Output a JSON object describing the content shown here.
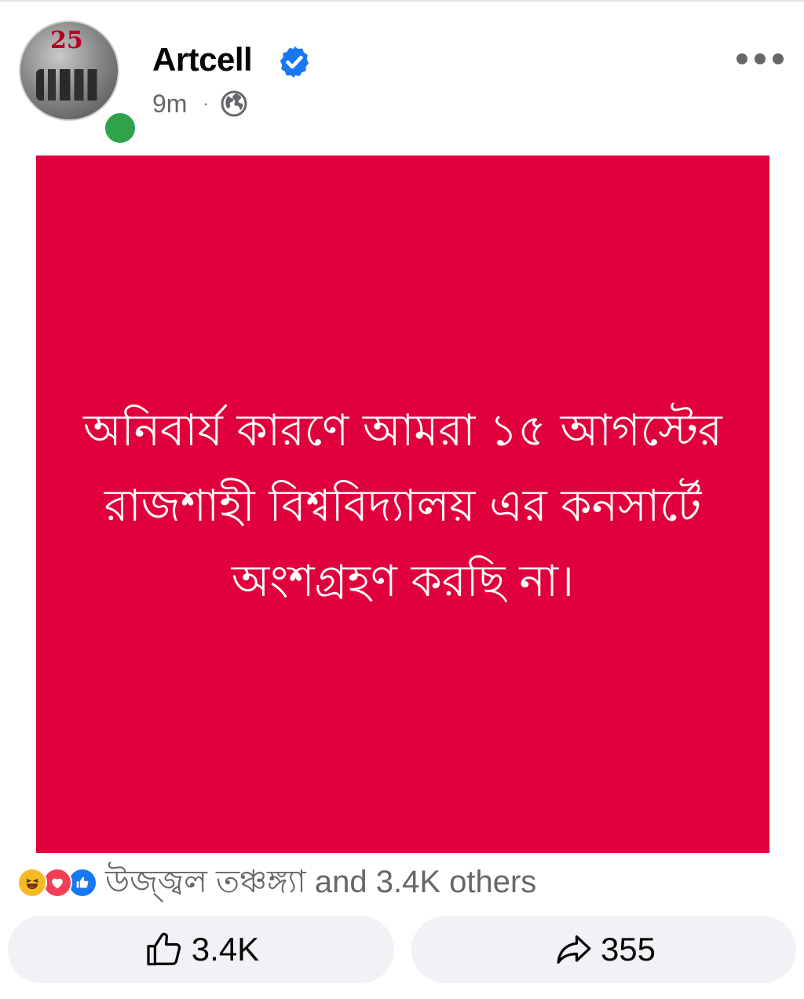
{
  "post": {
    "page_name": "Artcell",
    "time": "9m",
    "separator": "·",
    "avatar_badge": "25",
    "text": "অনিবার্য কারণে আমরা ১৫ আগস্টের রাজশাহী বিশ্ববিদ্যালয় এর কনসার্টে অংশগ্রহণ করছি না।",
    "card_color": "#e0003c"
  },
  "reactions": {
    "icons": [
      "haha-icon",
      "love-icon",
      "like-icon"
    ],
    "summary": "উজ্জ্বল তঞ্চঙ্গ্যা and 3.4K others"
  },
  "actions": {
    "like_count": "3.4K",
    "share_count": "355"
  },
  "colors": {
    "verified": "#1877f2",
    "online": "#31a24c",
    "secondary_text": "#65676b",
    "button_bg": "#f0f2f5"
  }
}
